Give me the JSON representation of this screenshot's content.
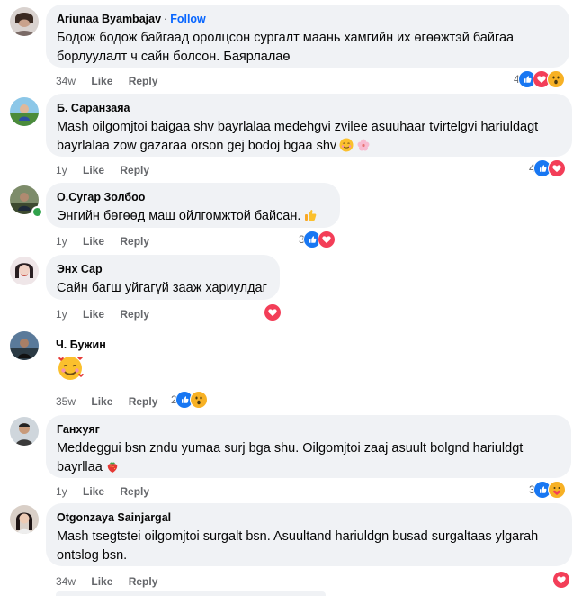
{
  "comments": [
    {
      "author": "Ariunaa Byambajav",
      "follow": "Follow",
      "text": "Бодож бодож байгаад оролцсон сургалт маань хамгийн их өгөөжтэй байгаа борлуулалт ч сайн болсон. Баярлалаө",
      "time": "34w",
      "like": "Like",
      "reply": "Reply",
      "reaction_count": "4",
      "reactions": [
        "like-icon",
        "love-icon",
        "wow-icon"
      ]
    },
    {
      "author": "Б. Саранзаяа",
      "text": "Mash oilgomjtoi baigaa shv bayrlalaa medehgvi zvilee asuuhaar tvirtelgvi hariuldagt bayrlalaa zow gazaraa orson gej bodoj bgaa shv",
      "time": "1y",
      "like": "Like",
      "reply": "Reply",
      "reaction_count": "4",
      "reactions": [
        "like-icon",
        "love-icon"
      ]
    },
    {
      "author": "О.Сугар Золбоо",
      "text": "Энгийн бөгөөд маш ойлгомжтой байсан.",
      "time": "1y",
      "like": "Like",
      "reply": "Reply",
      "reaction_count": "3",
      "reactions": [
        "like-icon",
        "love-icon"
      ]
    },
    {
      "author": "Энх Сар",
      "text": "Сайн багш уйгагүй зааж хариулдаг",
      "time": "1y",
      "like": "Like",
      "reply": "Reply",
      "reaction_count": "",
      "reactions": [
        "love-icon"
      ]
    },
    {
      "author": "Ч. Бужин",
      "text": "",
      "time": "35w",
      "like": "Like",
      "reply": "Reply",
      "reaction_count": "2",
      "reactions": [
        "like-icon",
        "wow-icon"
      ]
    },
    {
      "author": "Ганхуяг",
      "text": "Meddeggui bsn zndu yumaa surj bga shu. Oilgomjtoi zaaj asuult bolgnd hariuldgt bayrllaa",
      "time": "1y",
      "like": "Like",
      "reply": "Reply",
      "reaction_count": "3",
      "reactions": [
        "like-icon",
        "care-icon"
      ]
    },
    {
      "author": "Otgonzaya Sainjargal",
      "text": "Mash tsegtstei oilgomjtoi surgalt bsn. Asuultand hariuldgn busad surgaltaas ylgarah ontslog bsn.",
      "time": "34w",
      "like": "Like",
      "reply": "Reply",
      "reaction_count": "",
      "reactions": [
        "love-icon"
      ]
    }
  ],
  "colors": {
    "bubble": "#f0f2f5",
    "follow": "#0866ff",
    "meta": "#65676b",
    "like": "#1877f2",
    "love": "#f33e58",
    "wow": "#f7b125"
  }
}
